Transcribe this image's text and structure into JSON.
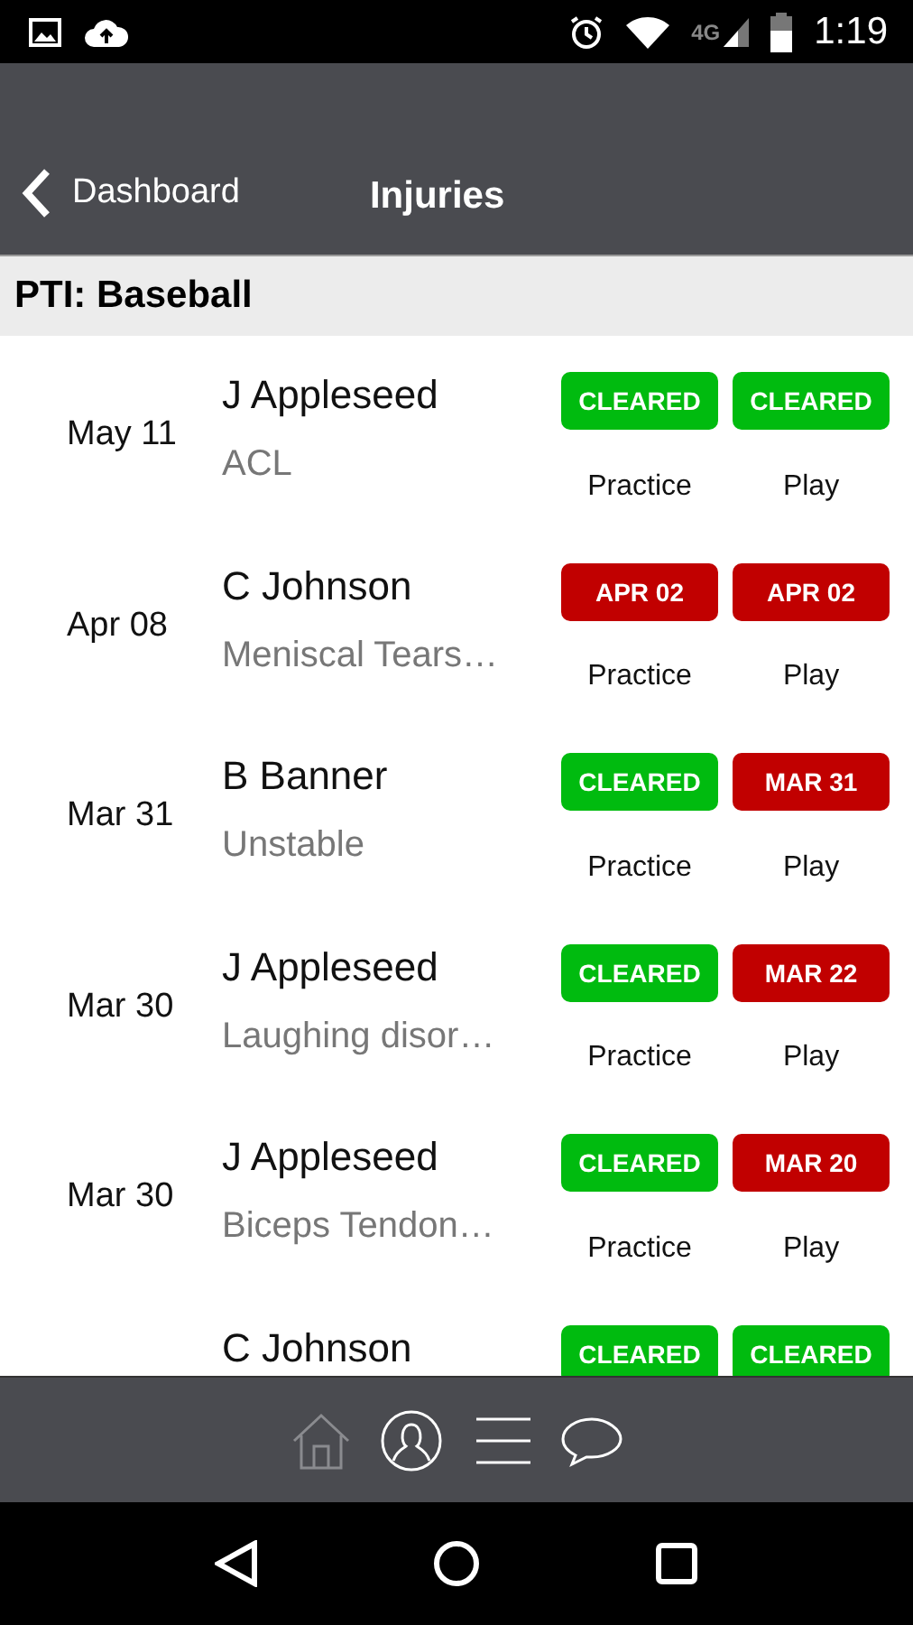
{
  "status_bar": {
    "time": "1:19",
    "network": "4G"
  },
  "header": {
    "back_label": "Dashboard",
    "title": "Injuries"
  },
  "section": {
    "title": "PTI: Baseball"
  },
  "injuries": [
    {
      "date": "May 11",
      "name": "J Appleseed",
      "injury": "ACL",
      "practice": {
        "kind": "cleared",
        "label": "CLEARED"
      },
      "play": {
        "kind": "cleared",
        "label": "CLEARED"
      },
      "practice_caption": "Practice",
      "play_caption": "Play"
    },
    {
      "date": "Apr 08",
      "name": "C Johnson",
      "injury": "Meniscal Tears…",
      "practice": {
        "kind": "date",
        "label": "APR 02"
      },
      "play": {
        "kind": "date",
        "label": "APR 02"
      },
      "practice_caption": "Practice",
      "play_caption": "Play"
    },
    {
      "date": "Mar 31",
      "name": "B Banner",
      "injury": "Unstable",
      "practice": {
        "kind": "cleared",
        "label": "CLEARED"
      },
      "play": {
        "kind": "date",
        "label": "MAR 31"
      },
      "practice_caption": "Practice",
      "play_caption": "Play"
    },
    {
      "date": "Mar 30",
      "name": "J Appleseed",
      "injury": "Laughing disor…",
      "practice": {
        "kind": "cleared",
        "label": "CLEARED"
      },
      "play": {
        "kind": "date",
        "label": "MAR 22"
      },
      "practice_caption": "Practice",
      "play_caption": "Play"
    },
    {
      "date": "Mar 30",
      "name": "J Appleseed",
      "injury": "Biceps Tendon…",
      "practice": {
        "kind": "cleared",
        "label": "CLEARED"
      },
      "play": {
        "kind": "date",
        "label": "MAR 20"
      },
      "practice_caption": "Practice",
      "play_caption": "Play"
    },
    {
      "name": "C Johnson",
      "practice": {
        "kind": "cleared",
        "label": "CLEARED"
      },
      "play": {
        "kind": "cleared",
        "label": "CLEARED"
      }
    }
  ],
  "bottom_nav": [
    {
      "kind": "home",
      "selected": true
    },
    {
      "kind": "profile",
      "selected": false
    },
    {
      "kind": "list",
      "selected": false
    },
    {
      "kind": "chat",
      "selected": false
    }
  ]
}
